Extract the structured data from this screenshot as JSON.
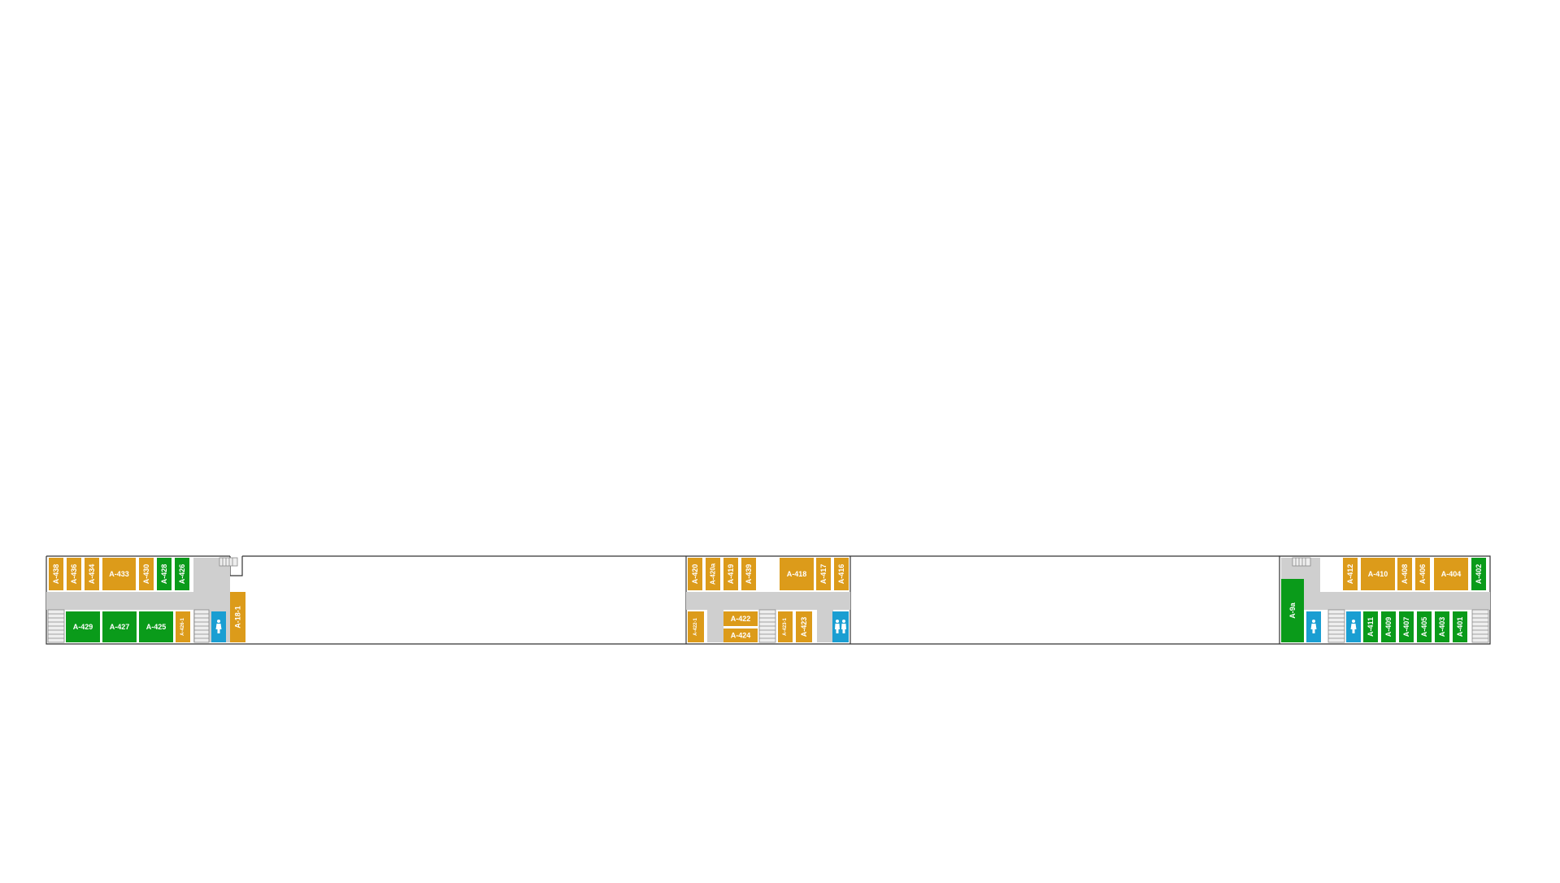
{
  "colors": {
    "orange": "#dc9b1a",
    "green": "#0a9b1a",
    "blue": "#1a9ed2",
    "corridor": "#cfcfcf",
    "outline": "#333333",
    "stair": "#888888"
  },
  "rooms": {
    "a438": "A-438",
    "a436": "A-436",
    "a434": "A-434",
    "a433": "A-433",
    "a430": "A-430",
    "a428": "A-428",
    "a426": "A-426",
    "a429": "A-429",
    "a427": "A-427",
    "a425": "A-425",
    "a426_1": "A-426-1",
    "a18_1": "A-18-1",
    "a420": "A-420",
    "a420a": "A-420a",
    "a419": "A-419",
    "a439": "A-439",
    "a418": "A-418",
    "a417": "A-417",
    "a416": "A-416",
    "a422_1": "A-422-1",
    "a422": "A-422",
    "a424": "A-424",
    "a423_1": "A-423-1",
    "a423": "A-423",
    "a9a": "A-9a",
    "a412": "A-412",
    "a410": "A-410",
    "a408": "A-408",
    "a406": "A-406",
    "a404": "A-404",
    "a402": "A-402",
    "a411": "A-411",
    "a409": "A-409",
    "a407": "A-407",
    "a405": "A-405",
    "a403": "A-403",
    "a401": "A-401"
  },
  "icons": {
    "restroom_west": "restroom-icon",
    "restroom_center": "restroom-icon",
    "restroom_east_1": "restroom-icon",
    "restroom_east_2": "restroom-icon"
  }
}
